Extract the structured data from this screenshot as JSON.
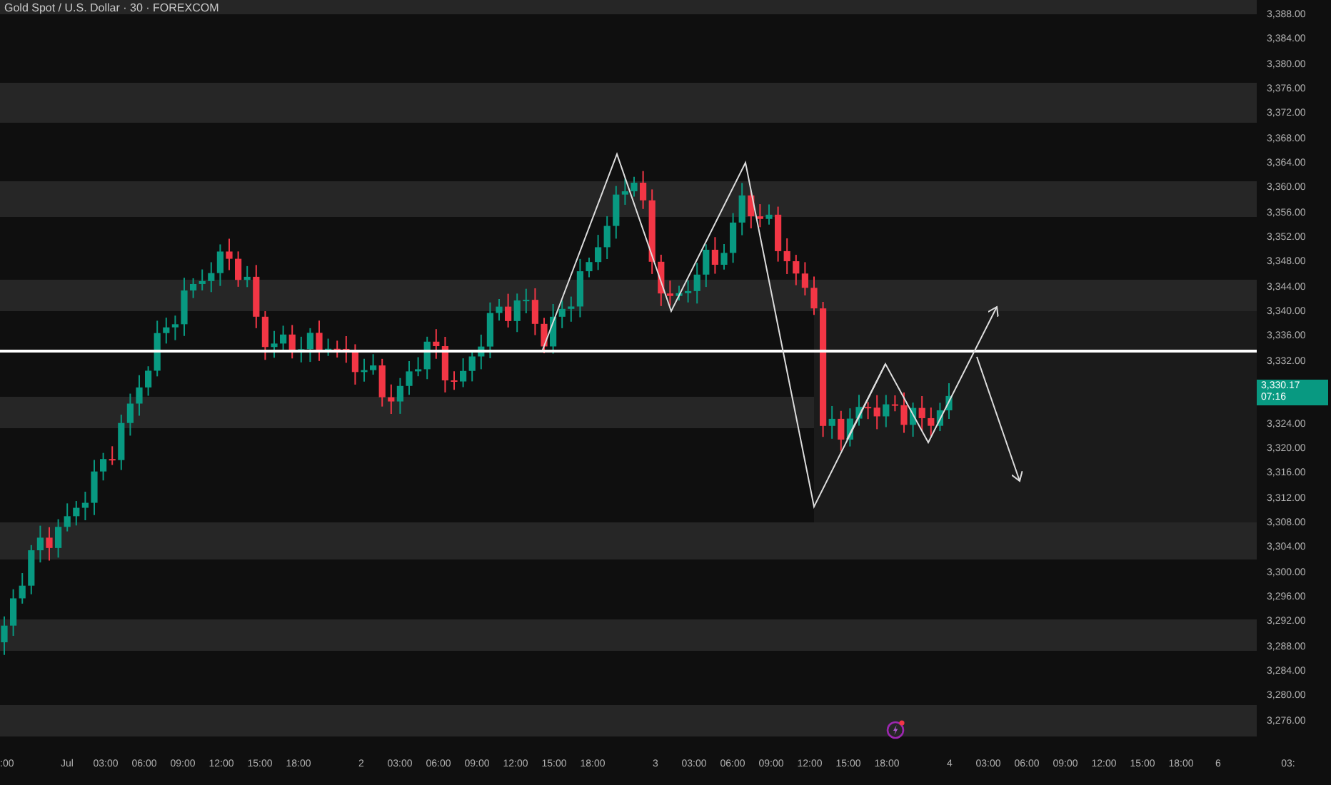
{
  "chart": {
    "title": "Gold Spot / U.S. Dollar · 30 · FOREXCOM"
  },
  "price_axis": {
    "items": [
      {
        "kind": "label",
        "text": "3,388.00"
      },
      {
        "kind": "label",
        "text": "3,384.00"
      },
      {
        "kind": "label",
        "text": "3,380.00"
      },
      {
        "kind": "label",
        "text": "3,376.00"
      },
      {
        "kind": "label",
        "text": "3,372.00"
      },
      {
        "kind": "label",
        "text": "3,368.00"
      },
      {
        "kind": "label",
        "text": "3,364.00"
      },
      {
        "kind": "label",
        "text": "3,360.00"
      },
      {
        "kind": "label",
        "text": "3,356.00"
      },
      {
        "kind": "label",
        "text": "3,352.00"
      },
      {
        "kind": "label",
        "text": "3,348.00"
      },
      {
        "kind": "label",
        "text": "3,344.00"
      },
      {
        "kind": "label",
        "text": "3,340.00"
      },
      {
        "kind": "label",
        "text": "3,336.00"
      },
      {
        "kind": "label",
        "text": "3,332.00"
      },
      {
        "kind": "badge",
        "text": "3,330.17",
        "countdown": "07:16"
      },
      {
        "kind": "label",
        "text": "3,324.00"
      },
      {
        "kind": "label",
        "text": "3,320.00"
      },
      {
        "kind": "label",
        "text": "3,316.00"
      },
      {
        "kind": "label",
        "text": "3,312.00"
      },
      {
        "kind": "label",
        "text": "3,308.00"
      },
      {
        "kind": "label",
        "text": "3,304.00"
      },
      {
        "kind": "label",
        "text": "3,300.00"
      },
      {
        "kind": "label",
        "text": "3,296.00"
      },
      {
        "kind": "label",
        "text": "3,292.00"
      },
      {
        "kind": "label",
        "text": "3,288.00"
      },
      {
        "kind": "label",
        "text": "3,284.00"
      },
      {
        "kind": "label",
        "text": "3,280.00"
      },
      {
        "kind": "label",
        "text": "3,276.00"
      }
    ]
  },
  "time_axis": {
    "labels": [
      ":00",
      "Jul",
      "03:00",
      "06:00",
      "09:00",
      "12:00",
      "15:00",
      "18:00",
      "2",
      "03:00",
      "06:00",
      "09:00",
      "12:00",
      "15:00",
      "18:00",
      "3",
      "03:00",
      "06:00",
      "09:00",
      "12:00",
      "15:00",
      "18:00",
      "4",
      "03:00",
      "06:00",
      "09:00",
      "12:00",
      "15:00",
      "18:00",
      "6",
      "03:"
    ]
  }
}
